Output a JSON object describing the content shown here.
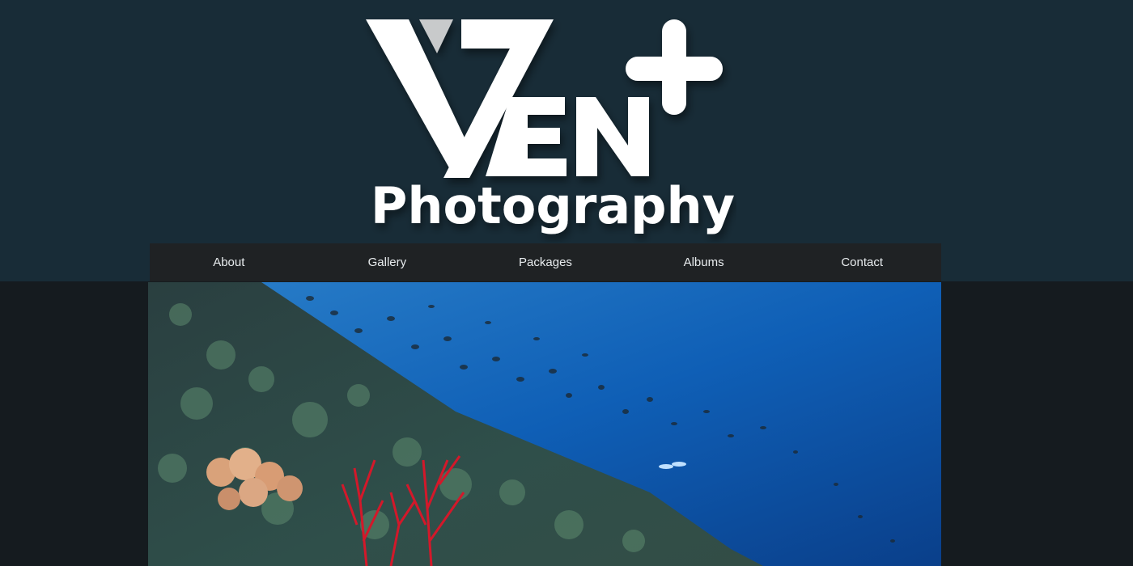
{
  "brand": {
    "logo_mark": "VEN+",
    "logo_tagline": "Photography",
    "colors": {
      "header_bg": "#182c37",
      "page_bg": "#151b1f",
      "nav_bg": "#1f2224",
      "logo_white": "#ffffff",
      "logo_accent": "#c8cacb"
    }
  },
  "nav": {
    "items": [
      {
        "label": "About"
      },
      {
        "label": "Gallery"
      },
      {
        "label": "Packages"
      },
      {
        "label": "Albums"
      },
      {
        "label": "Contact"
      }
    ]
  },
  "hero": {
    "image": "underwater-coral-reef-photo"
  }
}
